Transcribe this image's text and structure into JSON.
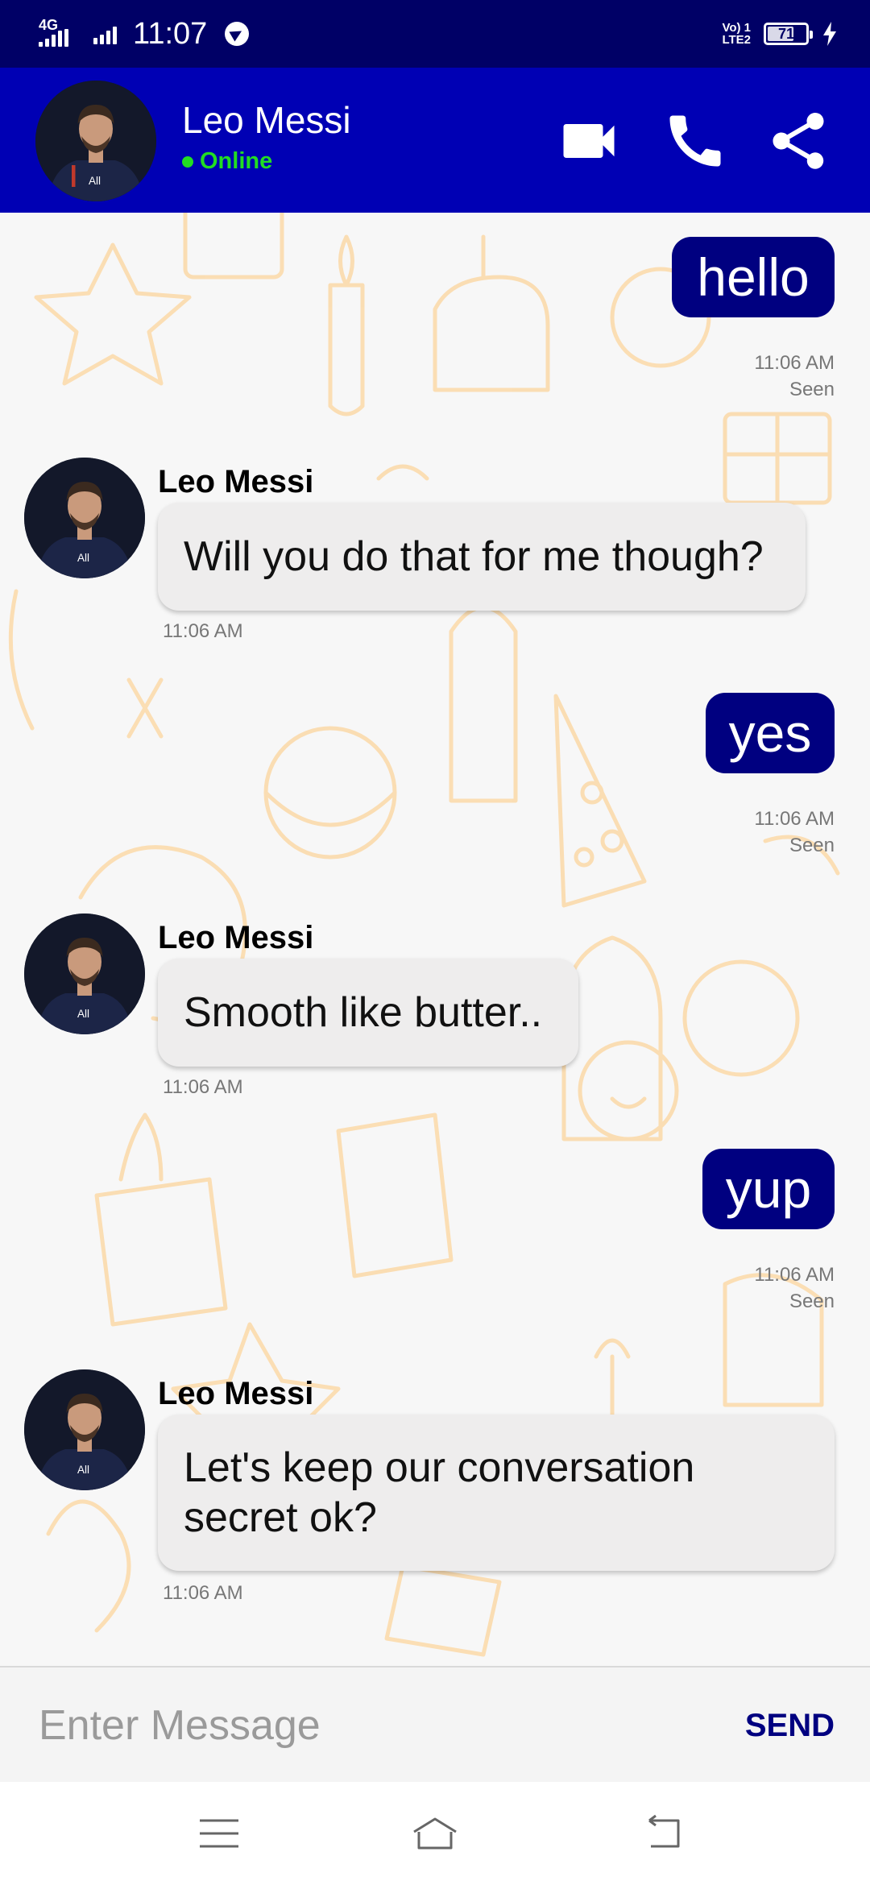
{
  "status_bar": {
    "network": "4G",
    "time": "11:07",
    "volte": "Vo) 1",
    "lte": "LTE2",
    "battery": "71",
    "battery_level": 0.71
  },
  "header": {
    "name": "Leo Messi",
    "status": "Online",
    "icons": [
      "video-call-icon",
      "phone-icon",
      "share-icon"
    ]
  },
  "messages": [
    {
      "dir": "out",
      "text": "hello",
      "time": "11:06 AM",
      "status": "Seen"
    },
    {
      "dir": "in",
      "sender": "Leo Messi",
      "text": "Will you do that for me though?",
      "time": "11:06 AM"
    },
    {
      "dir": "out",
      "text": "yes",
      "time": "11:06 AM",
      "status": "Seen"
    },
    {
      "dir": "in",
      "sender": "Leo Messi",
      "text": "Smooth like butter..",
      "time": "11:06 AM"
    },
    {
      "dir": "out",
      "text": "yup",
      "time": "11:06 AM",
      "status": "Seen"
    },
    {
      "dir": "in",
      "sender": "Leo Messi",
      "text": "Let's keep our conversation secret ok?",
      "time": "11:06 AM"
    }
  ],
  "composer": {
    "placeholder": "Enter Message",
    "send_label": "SEND"
  },
  "nav": {
    "icons": [
      "menu-icon",
      "home-icon",
      "back-icon"
    ]
  },
  "colors": {
    "status_bar": "#000066",
    "app_bar": "#0000b4",
    "outgoing_bubble": "#000080",
    "incoming_bubble": "#eeeded",
    "online": "#22dd22",
    "doodle": "#fbd9a8"
  }
}
